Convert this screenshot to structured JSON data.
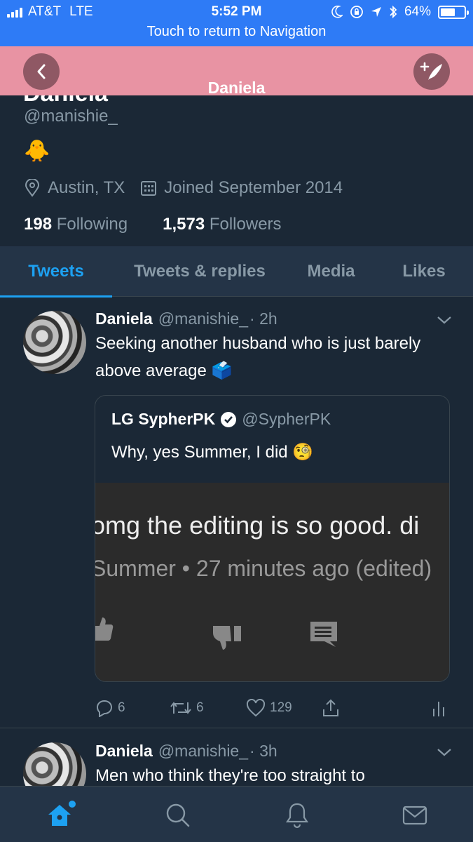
{
  "status_bar": {
    "carrier": "AT&T",
    "network": "LTE",
    "time": "5:52 PM",
    "battery": "64%",
    "battery_level": 0.64,
    "return_text": "Touch to return to Navigation",
    "icons": [
      "signal-icon",
      "moon-icon",
      "rotation-lock-icon",
      "location-arrow-icon",
      "bluetooth-icon",
      "battery-icon"
    ]
  },
  "header": {
    "title": "Daniela",
    "icons": [
      "back-chevron-icon",
      "compose-tweet-icon"
    ],
    "color": "#e893a3"
  },
  "profile": {
    "name": "Daniela",
    "handle": "@manishie_",
    "bio": "🐥",
    "location": "Austin, TX",
    "joined": "Joined September 2014",
    "following_count": "198",
    "following_label": "Following",
    "followers_count": "1,573",
    "followers_label": "Followers"
  },
  "tabs": [
    {
      "label": "Tweets",
      "active": true
    },
    {
      "label": "Tweets & replies",
      "active": false
    },
    {
      "label": "Media",
      "active": false
    },
    {
      "label": "Likes",
      "active": false
    }
  ],
  "tweets": [
    {
      "name": "Daniela",
      "handle": "@manishie_",
      "time": "· 2h",
      "text": "Seeking another husband who is just barely above average 🗳️",
      "quote": {
        "name": "LG SypherPK",
        "handle": "@SypherPK",
        "text": "Why, yes Summer, I did 🧐",
        "media_line1": "omg the editing is so good. di",
        "media_line2": "Summer • 27 minutes ago (edited)"
      },
      "replies": "6",
      "retweets": "6",
      "likes": "129"
    },
    {
      "name": "Daniela",
      "handle": "@manishie_",
      "time": "· 3h",
      "text": "Men who think they're too straight to"
    }
  ],
  "bottom_nav": {
    "items": [
      "home-icon",
      "search-icon",
      "notifications-icon",
      "messages-icon"
    ],
    "active": "home-icon"
  },
  "colors": {
    "accent": "#1da1f2",
    "background": "#1b2836",
    "status_bar": "#2e7bf6",
    "muted_text": "#8899a6"
  }
}
